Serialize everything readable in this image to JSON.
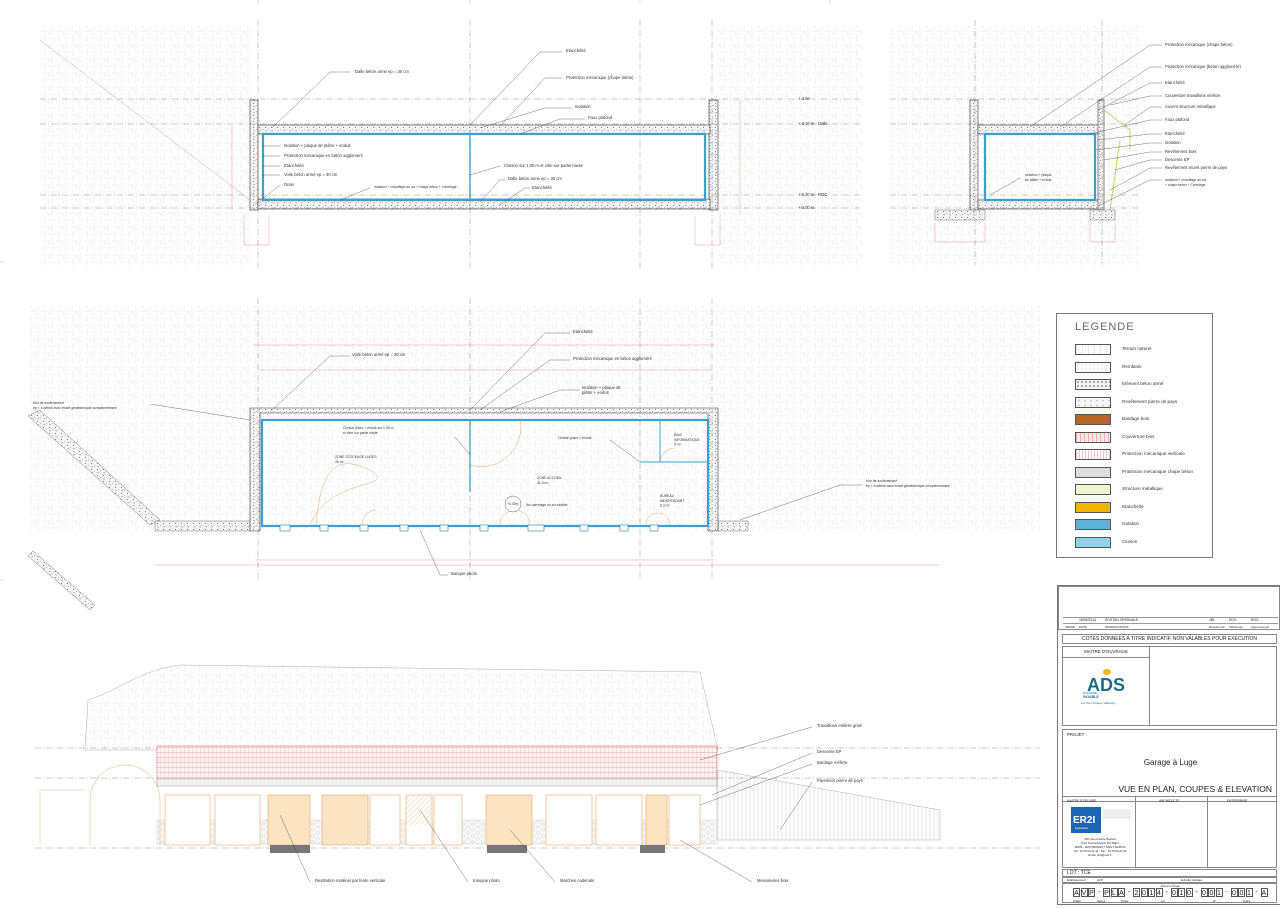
{
  "annotations": {
    "top_left": [
      "Dalle béton armé ep = 30 cm",
      "Etanchéité",
      "Protection mécanique (chape béton)",
      "Isolation",
      "Faux plafond",
      "Isolation + plaque de plâtre + enduit",
      "Protection mécanique en béton aggloméré",
      "Etanchéité",
      "Voile béton armé ep = 30 cm",
      "Drain",
      "Isolation + chauffage au sol\n+ chape béton + Carrelage",
      "Cloison sur 1,05 m et vitre sur partie haute",
      "Dalle béton armé ep = 30 cm",
      "Etanchéité"
    ],
    "top_right": [
      "Protection mécanique (chape béton)",
      "Protection mécanique (béton aggloméré)",
      "Etanchéité",
      "Couverture travaillons mélèze",
      "Auvent structure métallique",
      "Faux plafond",
      "Etanchéité",
      "Isolation",
      "Revêtement bois",
      "Descente EP",
      "Revêtement muret pierre de pays",
      "Isolation + chauffage au sol\n+ chape béton + Carrelage",
      "Isolation + plaque\nde plâtre + enduit"
    ],
    "levels": [
      "+ 3.66",
      "+ 3.16 m - Dalle",
      "+ 0.30 m - RDC",
      "+ 0.00 m"
    ],
    "plan": [
      "Etanchéité",
      "Voile béton armé ep = 30 cm",
      "Protection mécanique en béton aggloméré",
      "Isolation + plaque de\nplâtre + enduit",
      "Mur de soutènement\nep = à définir avec étude géotechnique complémentaire",
      "Cloison placo + enduit sur 1.05 m\net vitre sur partie haute",
      "Cloison placo + enduit",
      "BAIE\nINFORMATIQUE\n4 m²",
      "ZONE STOCKAGE LUGES\n46 m²",
      "ZONE ACCUEIL\n41.3 m²",
      "BUREAU\nINDEPENDANT\n5.3 m²",
      "Sol carrelage ou sol skiable",
      "Mur de soutènement\nep = à définir avec étude géotechnique complémentaire",
      "Banque photo"
    ],
    "plan_level": "+0.30m",
    "elevation": [
      "Travaillons mélèze grisé",
      "Descente EP",
      "Bardage mélèze",
      "Parement pierre de pays",
      "Restitution matériel par fente verticale",
      "Kiosque photo",
      "Marches cadenats",
      "Menuiseries bois"
    ]
  },
  "legend": {
    "title": "LEGENDE",
    "items": [
      {
        "label": "Terrain naturel",
        "swatch": "soil",
        "color": "#f2f2f2"
      },
      {
        "label": "Remblais",
        "swatch": "fill",
        "color": "#f6f6f6"
      },
      {
        "label": "Elément béton armé",
        "swatch": "concrete",
        "color": "#eeeeee"
      },
      {
        "label": "Revêtement pierre de pays",
        "swatch": "stone",
        "color": "#f0f0f0"
      },
      {
        "label": "Bardage bois",
        "swatch": "solid",
        "color": "#b5651d"
      },
      {
        "label": "Couverture bois",
        "swatch": "wood",
        "color": "#fbe9e9"
      },
      {
        "label": "Protection mécanique verticale",
        "swatch": "vert",
        "color": "#f5f5f5"
      },
      {
        "label": "Protection mécanique chape béton",
        "swatch": "solid",
        "color": "#dddddd"
      },
      {
        "label": "Structure métallique",
        "swatch": "solid",
        "color": "#eef7d0"
      },
      {
        "label": "Etanchéité",
        "swatch": "solid",
        "color": "#f4b400"
      },
      {
        "label": "Isolation",
        "swatch": "solid",
        "color": "#5bb4d8"
      },
      {
        "label": "Cloison",
        "swatch": "solid",
        "color": "#8fd3e8"
      }
    ]
  },
  "title_block": {
    "revision_date": "18/02/2014",
    "revision_label": "EDITION ORIGINALE",
    "revision_headers": [
      "INDICE",
      "DATE",
      "MODIFICATIONS",
      "Dessiné par",
      "Vérifié par",
      "Approuvé par"
    ],
    "revision_initials": [
      "JBL",
      "EDO",
      "RDO"
    ],
    "warning": "COTES DONNEES A TITRE INDICATIF, NON VALABLES POUR EXECUTION",
    "maitre_ouvrage_label": "MAITRE D'OUVRAGE",
    "logo_text": "ADS",
    "logo_sub1": "DOMAINE",
    "logo_sub2": "SKIABLE",
    "logo_sub3": "Les Arcs Peisey-Vallandry",
    "projet_label": "PROJET :",
    "projet_name": "Garage à Luge",
    "drawing_title": "VUE EN PLAN, COUPES & ELEVATION",
    "sub_headers": [
      "MAITRE D'OEUVRE",
      "ARCHITECTE",
      "ENTREPRISE"
    ],
    "moe_logo": "ER2I",
    "moe_logo_sub": "ingénierie",
    "moe_address": "365, Rue Antoine Boisset\nParc Technologique Pré Millet\n38330 - MONTBONNOT SAINT MARTIN\nTél : 04.76.04.21.42 - Fax : 04.76.04.21.52\nEmail: er2i@er2i.fr",
    "lot": "LOT : TCE",
    "phase_label": "Etablissement :",
    "phase_value": "AVP",
    "scale_label": "Echelle Globale :",
    "ref_caption": "Numéro Projet",
    "ref_parts": [
      "A",
      "V",
      "P",
      "-",
      "P",
      "L",
      "A",
      "-",
      "2",
      "0",
      "1",
      "4",
      "-",
      "0",
      "1",
      "0",
      "-",
      "0",
      "0",
      "1",
      "-",
      "0",
      "0",
      "1",
      "-",
      "A"
    ],
    "ref_footer": [
      "Phase",
      "Nature",
      "Projet",
      "Lot",
      "N°",
      "Indice"
    ]
  },
  "colors": {
    "insulation": "#3aa0d0",
    "dimension": "#d55555",
    "timber": "#e8a860",
    "roof_hatch": "#e07070"
  }
}
